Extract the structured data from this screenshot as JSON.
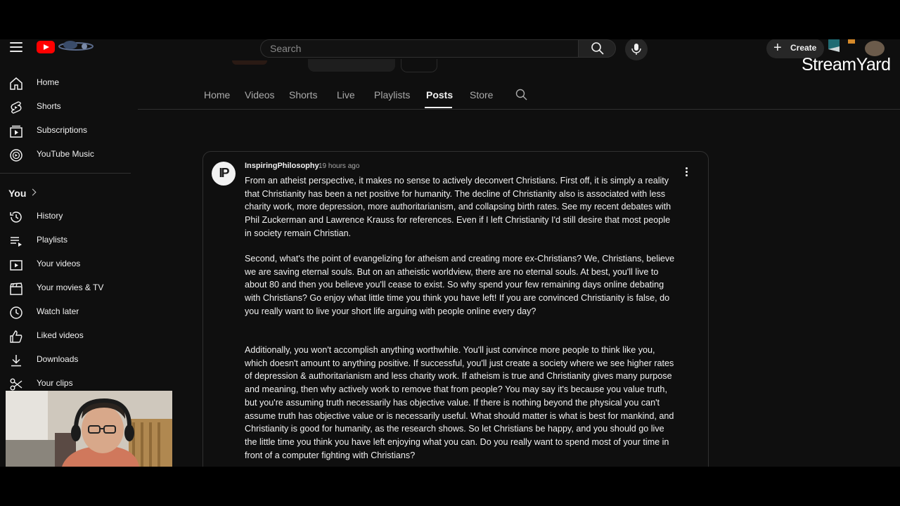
{
  "topbar": {
    "search_placeholder": "Search",
    "create_label": "Create",
    "overlay_brand": "StreamYard"
  },
  "channel_tabs": [
    "Home",
    "Videos",
    "Shorts",
    "Live",
    "Playlists",
    "Posts",
    "Store"
  ],
  "active_tab": "Posts",
  "sidebar": {
    "main": [
      {
        "label": "Home",
        "icon": "home-icon"
      },
      {
        "label": "Shorts",
        "icon": "shorts-icon"
      },
      {
        "label": "Subscriptions",
        "icon": "subscriptions-icon"
      },
      {
        "label": "YouTube Music",
        "icon": "youtube-music-icon"
      }
    ],
    "you_heading": "You",
    "you": [
      {
        "label": "History",
        "icon": "history-icon"
      },
      {
        "label": "Playlists",
        "icon": "playlists-icon"
      },
      {
        "label": "Your videos",
        "icon": "your-videos-icon"
      },
      {
        "label": "Your movies & TV",
        "icon": "movies-icon"
      },
      {
        "label": "Watch later",
        "icon": "clock-icon"
      },
      {
        "label": "Liked videos",
        "icon": "thumbs-up-icon"
      },
      {
        "label": "Downloads",
        "icon": "download-icon"
      },
      {
        "label": "Your clips",
        "icon": "scissors-icon"
      }
    ]
  },
  "post": {
    "author": "InspiringPhilosophy",
    "avatar_text": "IP",
    "time": "19 hours ago",
    "paragraphs": [
      "From an atheist perspective, it makes no sense to actively deconvert Christians. First off, it is simply a reality that Christianity has been a net positive for humanity. The decline of Christianity also is associated with less charity work, more depression, more authoritarianism, and collapsing birth rates. See my recent debates with Phil Zuckerman and Lawrence Krauss for references. Even if I left Christianity I'd still desire that most people in society remain Christian.",
      "Second, what's the point of evangelizing for atheism and creating more ex-Christians? We, Christians, believe we are saving eternal souls. But on an atheistic worldview, there are no eternal souls. At best, you'll live to about 80 and then you believe you'll cease to exist. So why spend your few remaining days online debating with Christians? Go enjoy what little time you think you have left! If you are convinced Christianity is false, do you really want to live your short life arguing with people online every day?",
      "Additionally, you won't accomplish anything worthwhile. You'll just convince more people to think like you, which doesn't amount to anything positive. If successful, you'll just create a society where we see higher rates of depression & authoritarianism and less charity work. If atheism is true and Christianity gives many purpose and meaning, then why actively work to remove that from people? You may say it's because you value truth, but you're assuming truth necessarily has objective value. If there is nothing beyond the physical you can't assume truth has objective value or is necessarily useful. What should matter is what is best for mankind, and Christianity is good for humanity, as the research shows. So let Christians be happy, and you should go live the little time you think you have left enjoying what you can. Do you really want to spend most of your time in front of a computer fighting with Christians?"
    ]
  },
  "colors": {
    "brand_red": "#ff0000",
    "background": "#0f0f0f",
    "text": "#f1f1f1",
    "muted": "#aaaaaa"
  }
}
